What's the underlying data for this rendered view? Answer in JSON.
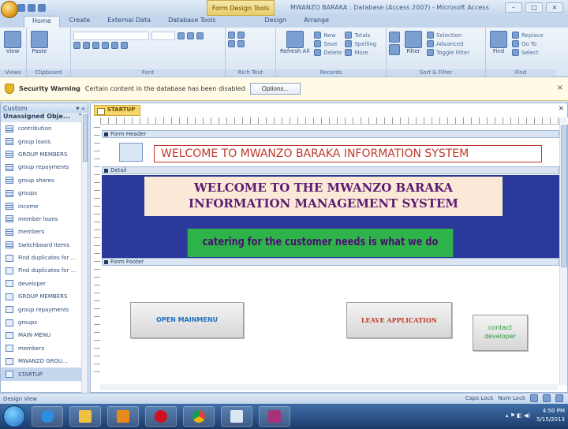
{
  "window": {
    "contextual_tab": "Form Design Tools",
    "title": "MWANZO BARAKA : Database (Access 2007) - Microsoft Access",
    "min": "–",
    "max": "□",
    "close": "×"
  },
  "ribbon_tabs": [
    "Home",
    "Create",
    "External Data",
    "Database Tools",
    "Design",
    "Arrange"
  ],
  "ribbon": {
    "view_label": "View",
    "paste_label": "Paste",
    "views_group": "Views",
    "clipboard_group": "Clipboard",
    "font_group": "Font",
    "richtext_group": "Rich Text",
    "refresh_label": "Refresh All",
    "records_new": "New",
    "records_save": "Save",
    "records_delete": "Delete",
    "records_totals": "Totals",
    "records_spelling": "Spelling",
    "records_more": "More",
    "records_group": "Records",
    "filter_label": "Filter",
    "filter_selection": "Selection",
    "filter_advanced": "Advanced",
    "filter_toggle": "Toggle Filter",
    "sortfilter_group": "Sort & Filter",
    "find_label": "Find",
    "find_replace": "Replace",
    "find_goto": "Go To",
    "find_select": "Select",
    "find_group": "Find"
  },
  "security": {
    "title": "Security Warning",
    "message": "Certain content in the database has been disabled",
    "options_button": "Options...",
    "close": "×"
  },
  "nav": {
    "header": "Custom",
    "group": "Unassigned Obje...",
    "items": [
      {
        "label": "contribution",
        "type": "table"
      },
      {
        "label": "group loans",
        "type": "table"
      },
      {
        "label": "GROUP MEMBERS",
        "type": "table"
      },
      {
        "label": "group repayments",
        "type": "table"
      },
      {
        "label": "group shares",
        "type": "table"
      },
      {
        "label": "groups",
        "type": "table"
      },
      {
        "label": "income",
        "type": "table"
      },
      {
        "label": "member loans",
        "type": "table"
      },
      {
        "label": "members",
        "type": "table"
      },
      {
        "label": "Switchboard Items",
        "type": "table"
      },
      {
        "label": "Find duplicates for ...",
        "type": "query"
      },
      {
        "label": "Find duplicates for ...",
        "type": "query"
      },
      {
        "label": "developer",
        "type": "form"
      },
      {
        "label": "GROUP MEMBERS",
        "type": "form"
      },
      {
        "label": "group repayments",
        "type": "form"
      },
      {
        "label": "groups",
        "type": "form"
      },
      {
        "label": "MAIN MENU",
        "type": "form"
      },
      {
        "label": "members",
        "type": "form"
      },
      {
        "label": "MWANZO GROU...",
        "type": "form"
      },
      {
        "label": "STARTUP",
        "type": "form",
        "selected": true
      }
    ]
  },
  "document": {
    "tab_label": "STARTUP",
    "close": "×",
    "form_header": "Form Header",
    "header_title": "WELCOME TO MWANZO BARAKA INFORMATION SYSTEM",
    "detail": "Detail",
    "welcome_line1": "WELCOME TO THE MWANZO BARAKA",
    "welcome_line2": "INFORMATION MANAGEMENT SYSTEM",
    "tagline": "catering for the customer needs is what we do",
    "form_footer": "Form Footer",
    "open_menu_button": "OPEN MAINMENU",
    "leave_button": "LEAVE APPLICATION",
    "contact_button_line1": "contact",
    "contact_button_line2": "developer"
  },
  "status": {
    "left": "Design View",
    "caps": "Caps Lock",
    "numlock": "Num Lock"
  },
  "tray": {
    "time": "4:50 PM",
    "date": "5/15/2013"
  },
  "colors": {
    "header_title": "#c0392b",
    "detail_bg": "#2b3a9a",
    "welcome_box": "#fbe8d7",
    "tagline_box": "#2eb34b",
    "open_button_text": "#1f6fbf",
    "leave_button_text": "#c0392b",
    "contact_button_text": "#2a9a3a"
  }
}
